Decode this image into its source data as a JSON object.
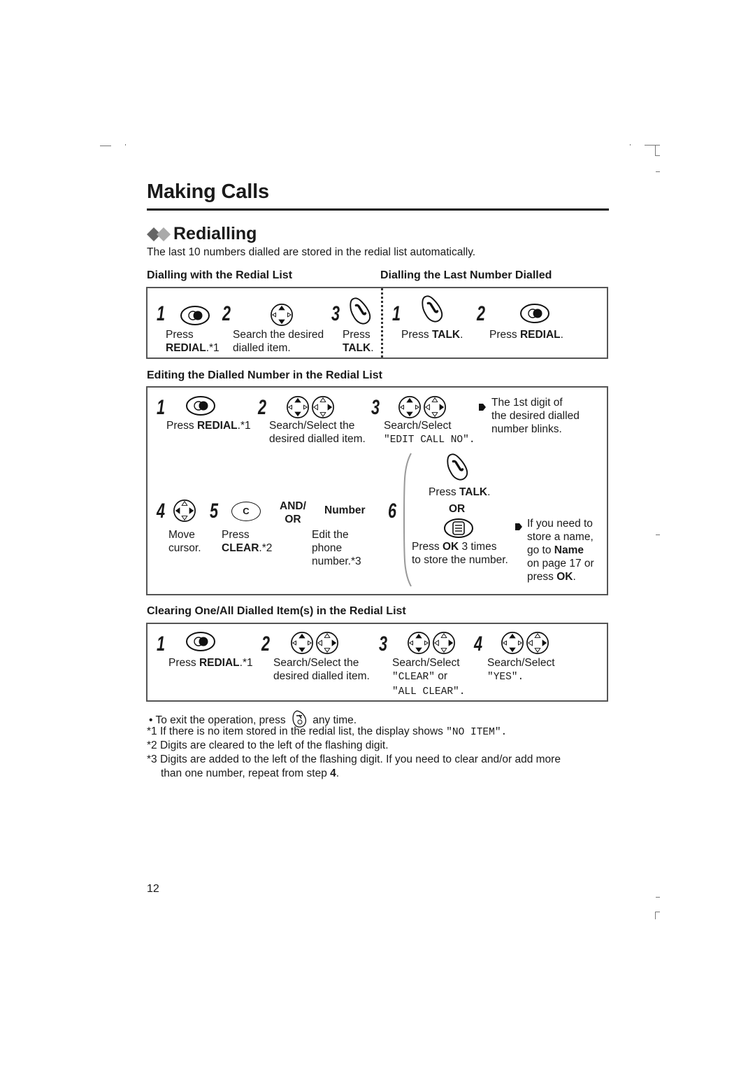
{
  "page": {
    "title": "Making Calls",
    "section_title": "Redialling",
    "intro": "The last 10 numbers dialled are stored in the redial list automatically.",
    "page_number": "12"
  },
  "dial_with_list": {
    "heading": "Dialling with the Redial List",
    "steps": [
      {
        "num": "1",
        "icon": "redial-button-icon",
        "line1": "Press",
        "bold": "REDIAL",
        "line2_suffix": ".*1"
      },
      {
        "num": "2",
        "icon": "navigator-up-down-icon",
        "line1": "Search the desired",
        "line2": "dialled item."
      },
      {
        "num": "3",
        "icon": "talk-button-icon",
        "line1": "Press",
        "bold": "TALK",
        "line2_suffix": "."
      }
    ]
  },
  "dial_last": {
    "heading": "Dialling the Last Number Dialled",
    "steps": [
      {
        "num": "1",
        "icon": "talk-button-icon",
        "prefix": "Press ",
        "bold": "TALK",
        "suffix": "."
      },
      {
        "num": "2",
        "icon": "redial-button-icon",
        "prefix": "Press ",
        "bold": "REDIAL",
        "suffix": "."
      }
    ]
  },
  "editing": {
    "heading": "Editing the Dialled Number in the Redial List",
    "step1": {
      "num": "1",
      "prefix": "Press ",
      "bold": "REDIAL",
      "suffix": ".*1"
    },
    "step2": {
      "num": "2",
      "line1": "Search/Select the",
      "line2": "desired dialled item."
    },
    "step3": {
      "num": "3",
      "line1": "Search/Select",
      "display": "\"EDIT CALL NO\"."
    },
    "step3_result": [
      "The 1st digit of",
      "the desired dialled",
      "number blinks."
    ],
    "step4": {
      "num": "4",
      "line1": "Move",
      "line2": "cursor."
    },
    "step5": {
      "num": "5",
      "key_label": "C",
      "line1": "Press",
      "bold": "CLEAR",
      "suffix": ".*2"
    },
    "and_or": [
      "AND/",
      "OR"
    ],
    "number_key": "Number",
    "number_desc": [
      "Edit the",
      "phone",
      "number.*3"
    ],
    "step6": {
      "num": "6",
      "option_a": {
        "prefix": "Press ",
        "bold": "TALK",
        "suffix": "."
      },
      "or": "OR",
      "option_b": {
        "prefix": "Press ",
        "bold": "OK",
        "suffix": " 3 times",
        "line2": "to store the number."
      },
      "result": {
        "l1": "If you need to",
        "l2": "store a name,",
        "l3_prefix": "go to ",
        "l3_bold": "Name",
        "l4": "on page 17 or",
        "l5_prefix": "press ",
        "l5_bold": "OK",
        "l5_suffix": "."
      }
    }
  },
  "clearing": {
    "heading": "Clearing One/All Dialled Item(s) in the Redial List",
    "step1": {
      "num": "1",
      "prefix": "Press ",
      "bold": "REDIAL",
      "suffix": ".*1"
    },
    "step2": {
      "num": "2",
      "line1": "Search/Select the",
      "line2": "desired dialled item."
    },
    "step3": {
      "num": "3",
      "line1": "Search/Select",
      "display1": "\"CLEAR\"",
      "or_word": " or",
      "display2": "\"ALL CLEAR\"."
    },
    "step4": {
      "num": "4",
      "line1": "Search/Select",
      "display": "\"YES\"."
    }
  },
  "notes": {
    "bullet_prefix": "To exit the operation, press",
    "bullet_suffix": "any time.",
    "fn1_mark": "*1",
    "fn1_text": "If there is no item stored in the redial list, the display shows ",
    "fn1_display": "\"NO ITEM\".",
    "fn2_mark": "*2",
    "fn2_text": "Digits are cleared to the left of the flashing digit.",
    "fn3_mark": "*3",
    "fn3_text": "Digits are added to the left of the flashing digit. If you need to clear and/or add more",
    "fn3_line2": "than one number, repeat from step ",
    "fn3_bold": "4",
    "fn3_end": "."
  }
}
